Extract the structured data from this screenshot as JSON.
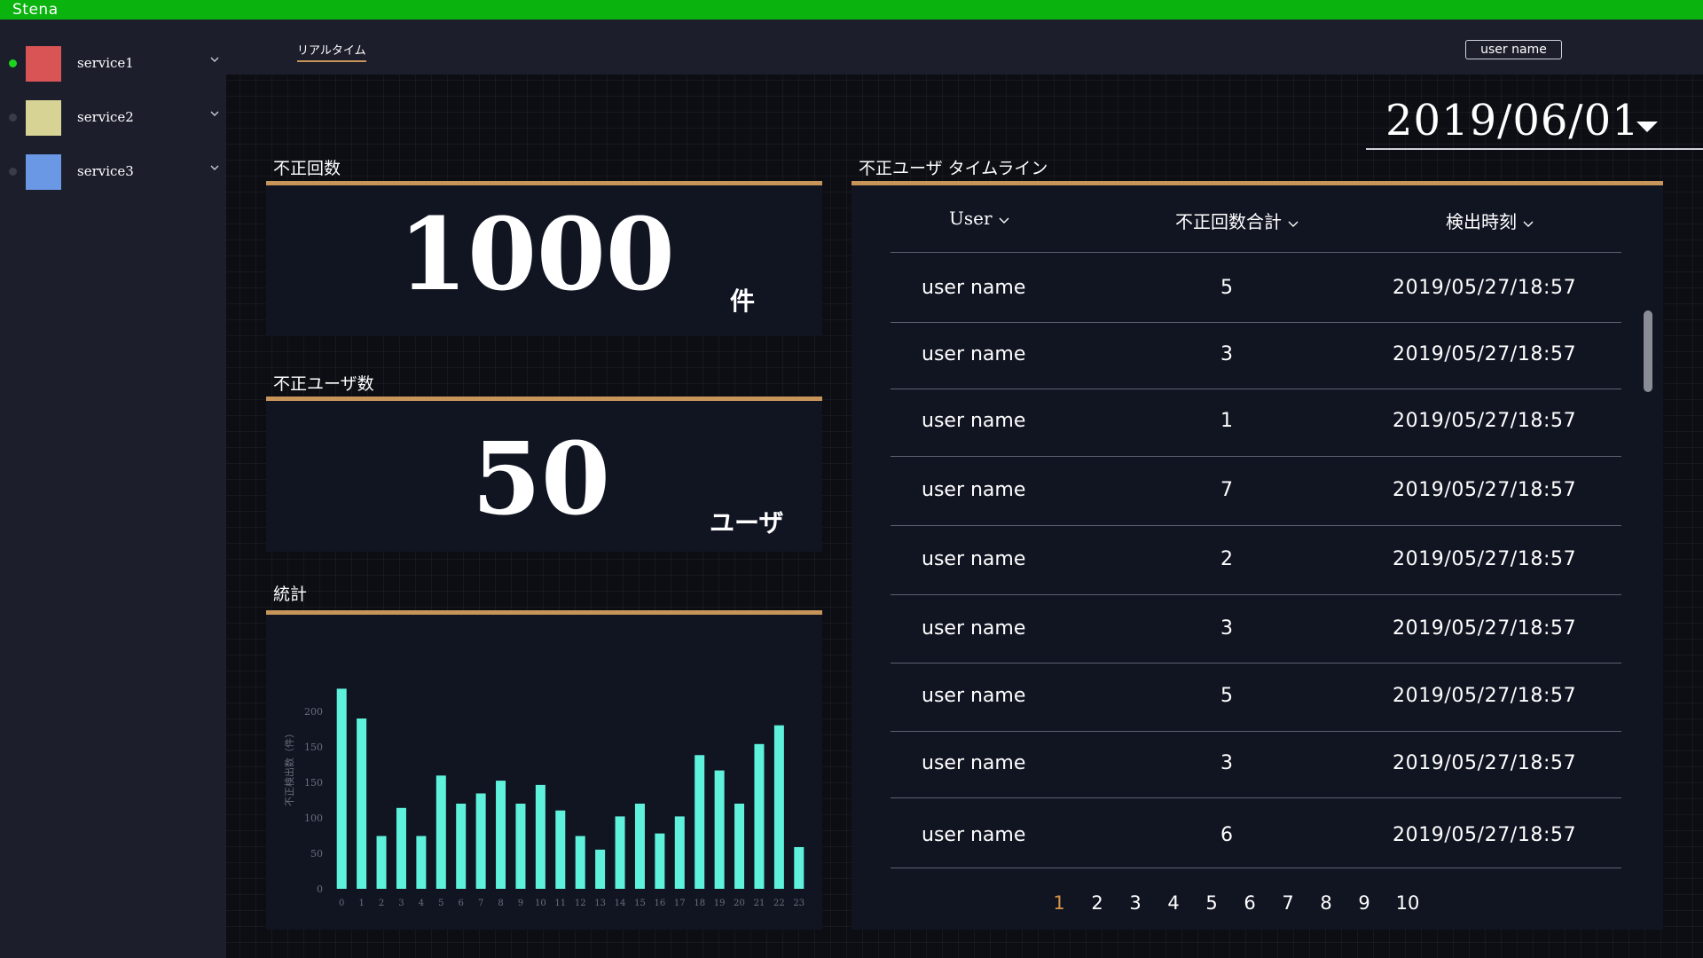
{
  "app": {
    "title": "Stena"
  },
  "colors": {
    "topbar": "#0bb30f",
    "accent": "#c7945a",
    "bar": "#5ef2dc",
    "active_page": "#d59348"
  },
  "sidebar": {
    "items": [
      {
        "label": "service1",
        "color": "#d95555",
        "status_color": "#1ed41e",
        "icon": "chevron-down-icon"
      },
      {
        "label": "service2",
        "color": "#d6d394",
        "status_color": "#3a3d48",
        "icon": "chevron-down-icon"
      },
      {
        "label": "service3",
        "color": "#6a98e4",
        "status_color": "#3a3d48",
        "icon": "chevron-down-icon"
      }
    ]
  },
  "header": {
    "tab": "リアルタイム",
    "user_button": "user name"
  },
  "date_picker": {
    "value": "2019/06/01",
    "icon": "caret-down-icon"
  },
  "fraud_count": {
    "title": "不正回数",
    "value": "1000",
    "unit": "件"
  },
  "fraud_users": {
    "title": "不正ユーザ数",
    "value": "50",
    "unit": "ユーザ"
  },
  "stats": {
    "title": "統計"
  },
  "timeline": {
    "title": "不正ユーザ タイムライン",
    "columns": [
      "User",
      "不正回数合計",
      "検出時刻"
    ],
    "rows": [
      {
        "user": "user name",
        "count": "5",
        "time": "2019/05/27/18:57"
      },
      {
        "user": "user name",
        "count": "3",
        "time": "2019/05/27/18:57"
      },
      {
        "user": "user name",
        "count": "1",
        "time": "2019/05/27/18:57"
      },
      {
        "user": "user name",
        "count": "7",
        "time": "2019/05/27/18:57"
      },
      {
        "user": "user name",
        "count": "2",
        "time": "2019/05/27/18:57"
      },
      {
        "user": "user name",
        "count": "3",
        "time": "2019/05/27/18:57"
      },
      {
        "user": "user name",
        "count": "5",
        "time": "2019/05/27/18:57"
      },
      {
        "user": "user name",
        "count": "3",
        "time": "2019/05/27/18:57"
      },
      {
        "user": "user name",
        "count": "6",
        "time": "2019/05/27/18:57"
      }
    ],
    "pages": [
      "1",
      "2",
      "3",
      "4",
      "5",
      "6",
      "7",
      "8",
      "9",
      "10"
    ],
    "active_page": "1"
  },
  "chart_data": {
    "type": "bar",
    "categories": [
      "0",
      "1",
      "2",
      "3",
      "4",
      "5",
      "6",
      "7",
      "8",
      "9",
      "10",
      "11",
      "12",
      "13",
      "14",
      "15",
      "16",
      "17",
      "18",
      "19",
      "20",
      "21",
      "22",
      "23"
    ],
    "values": [
      235,
      200,
      62,
      95,
      62,
      133,
      100,
      112,
      127,
      100,
      122,
      92,
      62,
      46,
      85,
      100,
      65,
      85,
      157,
      139,
      100,
      170,
      192,
      49
    ],
    "ylabel": "不正検出数（件）",
    "y_ticks": [
      "0",
      "50",
      "100",
      "150",
      "150",
      "200"
    ],
    "ylim": [
      0,
      250
    ],
    "grid": false,
    "legend": "none"
  }
}
